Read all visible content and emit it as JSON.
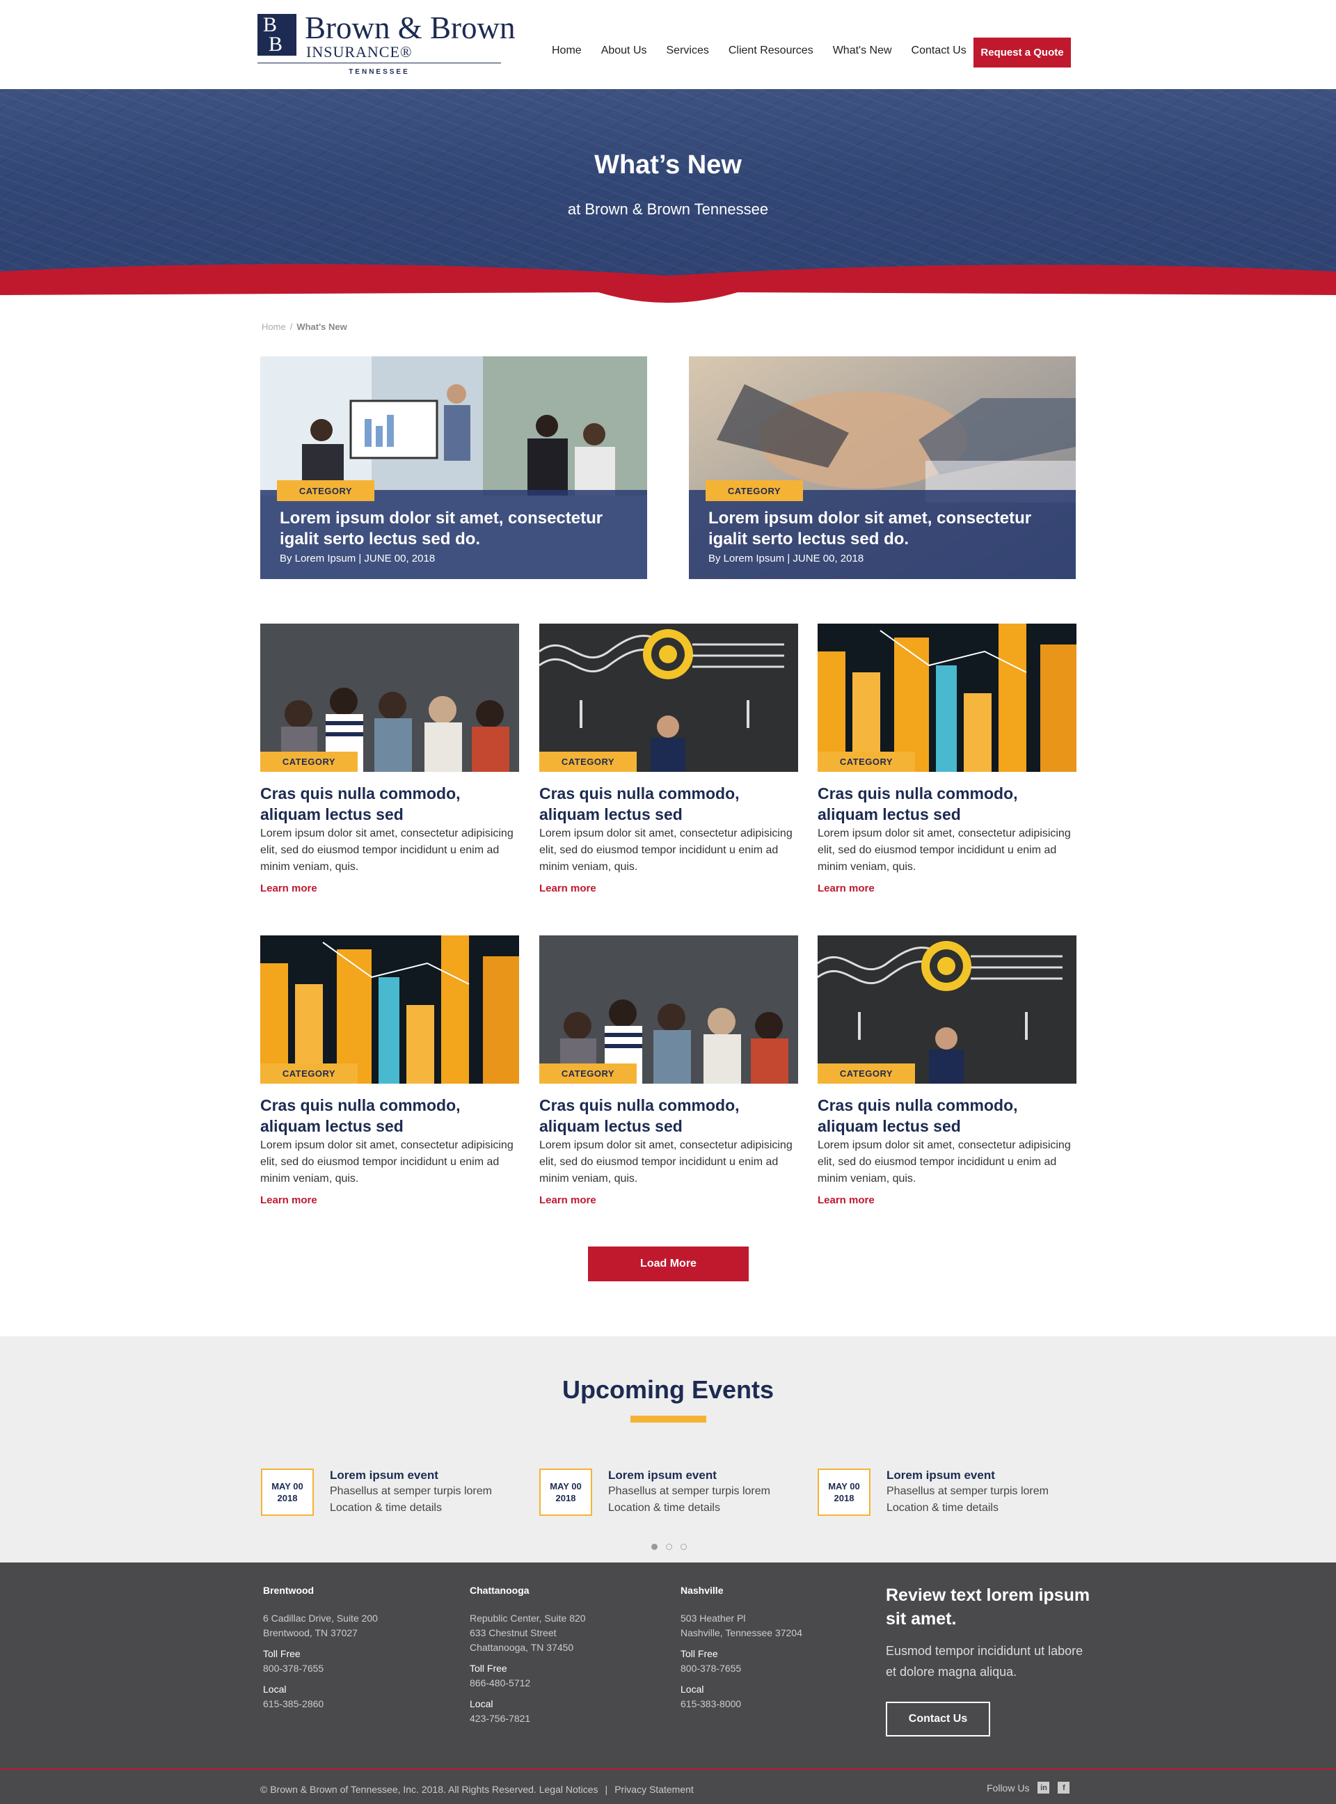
{
  "header": {
    "logo_mark_top": "B",
    "logo_mark_bottom": "B",
    "logo_title": "Brown & Brown",
    "logo_sub": "INSURANCE®",
    "logo_state": "TENNESSEE",
    "nav": [
      "Home",
      "About Us",
      "Services",
      "Client Resources",
      "What's New",
      "Contact Us"
    ],
    "cta": "Request a Quote"
  },
  "hero": {
    "title": "What’s New",
    "subtitle": "at Brown & Brown Tennessee"
  },
  "breadcrumb": {
    "home": "Home",
    "separator": "/",
    "current": "What's New"
  },
  "featured": [
    {
      "category": "CATEGORY",
      "title": "Lorem ipsum dolor sit amet, consectetur igalit serto lectus sed do.",
      "meta": "By Lorem Ipsum  |  JUNE 00, 2018"
    },
    {
      "category": "CATEGORY",
      "title": "Lorem ipsum dolor sit amet, consectetur igalit serto lectus sed do.",
      "meta": "By Lorem Ipsum  |  JUNE 00, 2018"
    }
  ],
  "cards": [
    {
      "category": "CATEGORY",
      "title": "Cras quis nulla commodo, aliquam lectus sed",
      "body": "Lorem ipsum dolor sit amet, consectetur adipisicing elit, sed do eiusmod tempor incididunt u enim ad minim veniam, quis.",
      "link": "Learn more"
    },
    {
      "category": "CATEGORY",
      "title": "Cras quis nulla commodo, aliquam lectus sed",
      "body": "Lorem ipsum dolor sit amet, consectetur adipisicing elit, sed do eiusmod tempor incididunt u enim ad minim veniam, quis.",
      "link": "Learn more"
    },
    {
      "category": "CATEGORY",
      "title": "Cras quis nulla commodo, aliquam lectus sed",
      "body": "Lorem ipsum dolor sit amet, consectetur adipisicing elit, sed do eiusmod tempor incididunt u enim ad minim veniam, quis.",
      "link": "Learn more"
    },
    {
      "category": "CATEGORY",
      "title": "Cras quis nulla commodo, aliquam lectus sed",
      "body": "Lorem ipsum dolor sit amet, consectetur adipisicing elit, sed do eiusmod tempor incididunt u enim ad minim veniam, quis.",
      "link": "Learn more"
    },
    {
      "category": "CATEGORY",
      "title": "Cras quis nulla commodo, aliquam lectus sed",
      "body": "Lorem ipsum dolor sit amet, consectetur adipisicing elit, sed do eiusmod tempor incididunt u enim ad minim veniam, quis.",
      "link": "Learn more"
    },
    {
      "category": "CATEGORY",
      "title": "Cras quis nulla commodo, aliquam lectus sed",
      "body": "Lorem ipsum dolor sit amet, consectetur adipisicing elit, sed do eiusmod tempor incididunt u enim ad minim veniam, quis.",
      "link": "Learn more"
    }
  ],
  "load_more": "Load More",
  "events": {
    "title": "Upcoming Events",
    "items": [
      {
        "date_line1": "MAY 00",
        "date_line2": "2018",
        "title": "Lorem ipsum event",
        "line1": "Phasellus at semper turpis lorem",
        "line2": "Location & time details"
      },
      {
        "date_line1": "MAY 00",
        "date_line2": "2018",
        "title": "Lorem ipsum event",
        "line1": "Phasellus at semper turpis lorem",
        "line2": "Location & time details"
      },
      {
        "date_line1": "MAY 00",
        "date_line2": "2018",
        "title": "Lorem ipsum event",
        "line1": "Phasellus at semper turpis lorem",
        "line2": "Location & time details"
      }
    ]
  },
  "footer": {
    "locations": [
      {
        "city": "Brentwood",
        "address1": "6 Cadillac Drive, Suite 200",
        "address2": "Brentwood, TN 37027",
        "address3": "",
        "toll_label": "Toll Free",
        "toll": "800-378-7655",
        "local_label": "Local",
        "local": "615-385-2860"
      },
      {
        "city": "Chattanooga",
        "address1": "Republic Center, Suite 820",
        "address2": "633 Chestnut Street",
        "address3": "Chattanooga, TN 37450",
        "toll_label": "Toll Free",
        "toll": "866-480-5712",
        "local_label": "Local",
        "local": "423-756-7821"
      },
      {
        "city": "Nashville",
        "address1": "503 Heather Pl",
        "address2": "Nashville, Tennessee 37204",
        "address3": "",
        "toll_label": "Toll Free",
        "toll": "800-378-7655",
        "local_label": "Local",
        "local": "615-383-8000"
      }
    ],
    "review_title": "Review text lorem ipsum sit amet.",
    "review_body": "Eusmod tempor incididunt ut labore et dolore magna aliqua.",
    "contact_btn": "Contact Us",
    "copyright": "© Brown & Brown of Tennessee, Inc. 2018. All Rights Reserved. Legal Notices",
    "privacy": "Privacy Statement",
    "separator": "|",
    "follow": "Follow Us"
  },
  "colors": {
    "navy": "#1d2b52",
    "red": "#c0192e",
    "gold": "#f5b335",
    "footer": "#4a4a4c"
  }
}
